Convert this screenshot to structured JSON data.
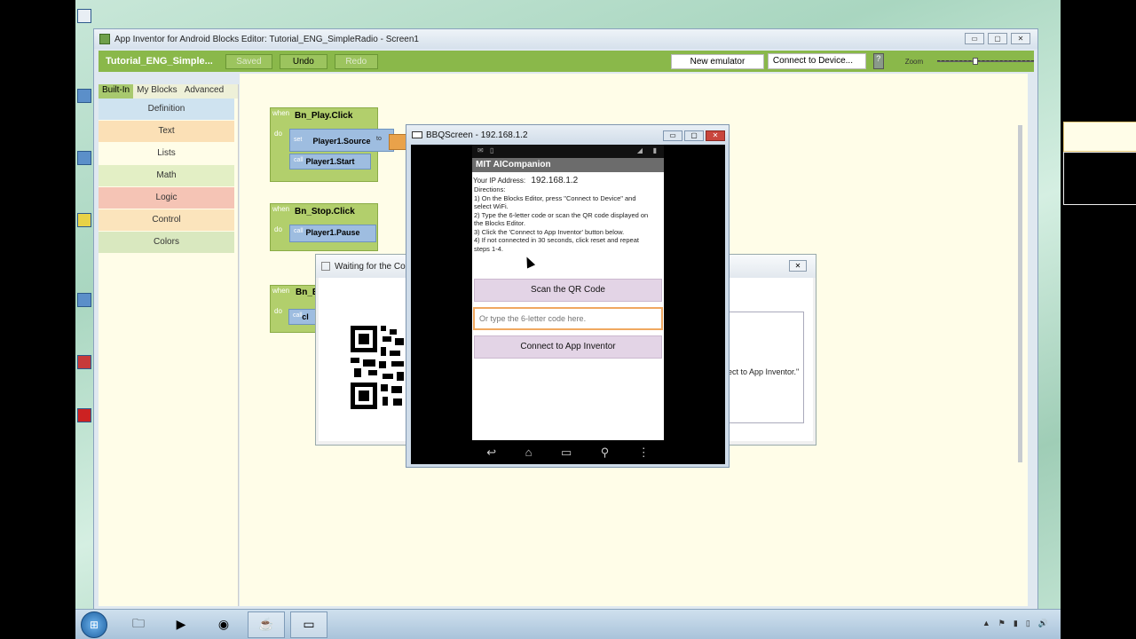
{
  "window": {
    "title": "App Inventor for Android Blocks Editor: Tutorial_ENG_SimpleRadio - Screen1",
    "min": "▭",
    "max": "▢",
    "close": "✕"
  },
  "toolbar": {
    "project": "Tutorial_ENG_Simple...",
    "saved": "Saved",
    "undo": "Undo",
    "redo": "Redo",
    "new_emulator": "New emulator",
    "connect": "Connect to Device...",
    "zoom": "Zoom"
  },
  "sidebar": {
    "tabs": [
      "Built-In",
      "My Blocks",
      "Advanced"
    ],
    "drawers": [
      {
        "label": "Definition",
        "color": "#cfe3f0"
      },
      {
        "label": "Text",
        "color": "#fbe0b6"
      },
      {
        "label": "Lists",
        "color": "#fffde8"
      },
      {
        "label": "Math",
        "color": "#e3efc5"
      },
      {
        "label": "Logic",
        "color": "#f5c4b5"
      },
      {
        "label": "Control",
        "color": "#fbe4bc"
      },
      {
        "label": "Colors",
        "color": "#d9e8bf"
      }
    ]
  },
  "blocks": {
    "when": "when",
    "do": "do",
    "set": "set",
    "call": "call",
    "to": "to",
    "play_event": "Bn_Play.Click",
    "player_source": "Player1.Source",
    "player_start": "Player1.Start",
    "stop_event": "Bn_Stop.Click",
    "player_pause": "Player1.Pause",
    "third_event": "Bn_E",
    "third_call": "cl"
  },
  "wait_dialog": {
    "title": "Waiting for the Con",
    "message": "nect to App Inventor.\"",
    "close": "✕"
  },
  "bbq": {
    "title": "BBQScreen - 192.168.1.2",
    "app_title": "MIT AICompanion",
    "ip_label": "Your IP Address:",
    "ip": "192.168.1.2",
    "directions": [
      "Directions:",
      "1) On the Blocks Editor, press \"Connect to Device\" and",
      "select WiFi.",
      "2) Type the 6-letter code or scan the QR code displayed on",
      "the Blocks Editor.",
      "3) Click the 'Connect to App Inventor' button below.",
      "4) If not connected in 30 seconds, click reset and repeat",
      "steps 1-4."
    ],
    "scan_button": "Scan the QR Code",
    "code_placeholder": "Or type the 6-letter code here.",
    "connect_button": "Connect to App Inventor"
  },
  "taskbar": {
    "start": "⊞",
    "items": [
      "🗀",
      "▶",
      "◉",
      "☕",
      "▭"
    ],
    "tray": [
      "▲",
      "⚑",
      "▮",
      "▯",
      "🔊"
    ]
  }
}
